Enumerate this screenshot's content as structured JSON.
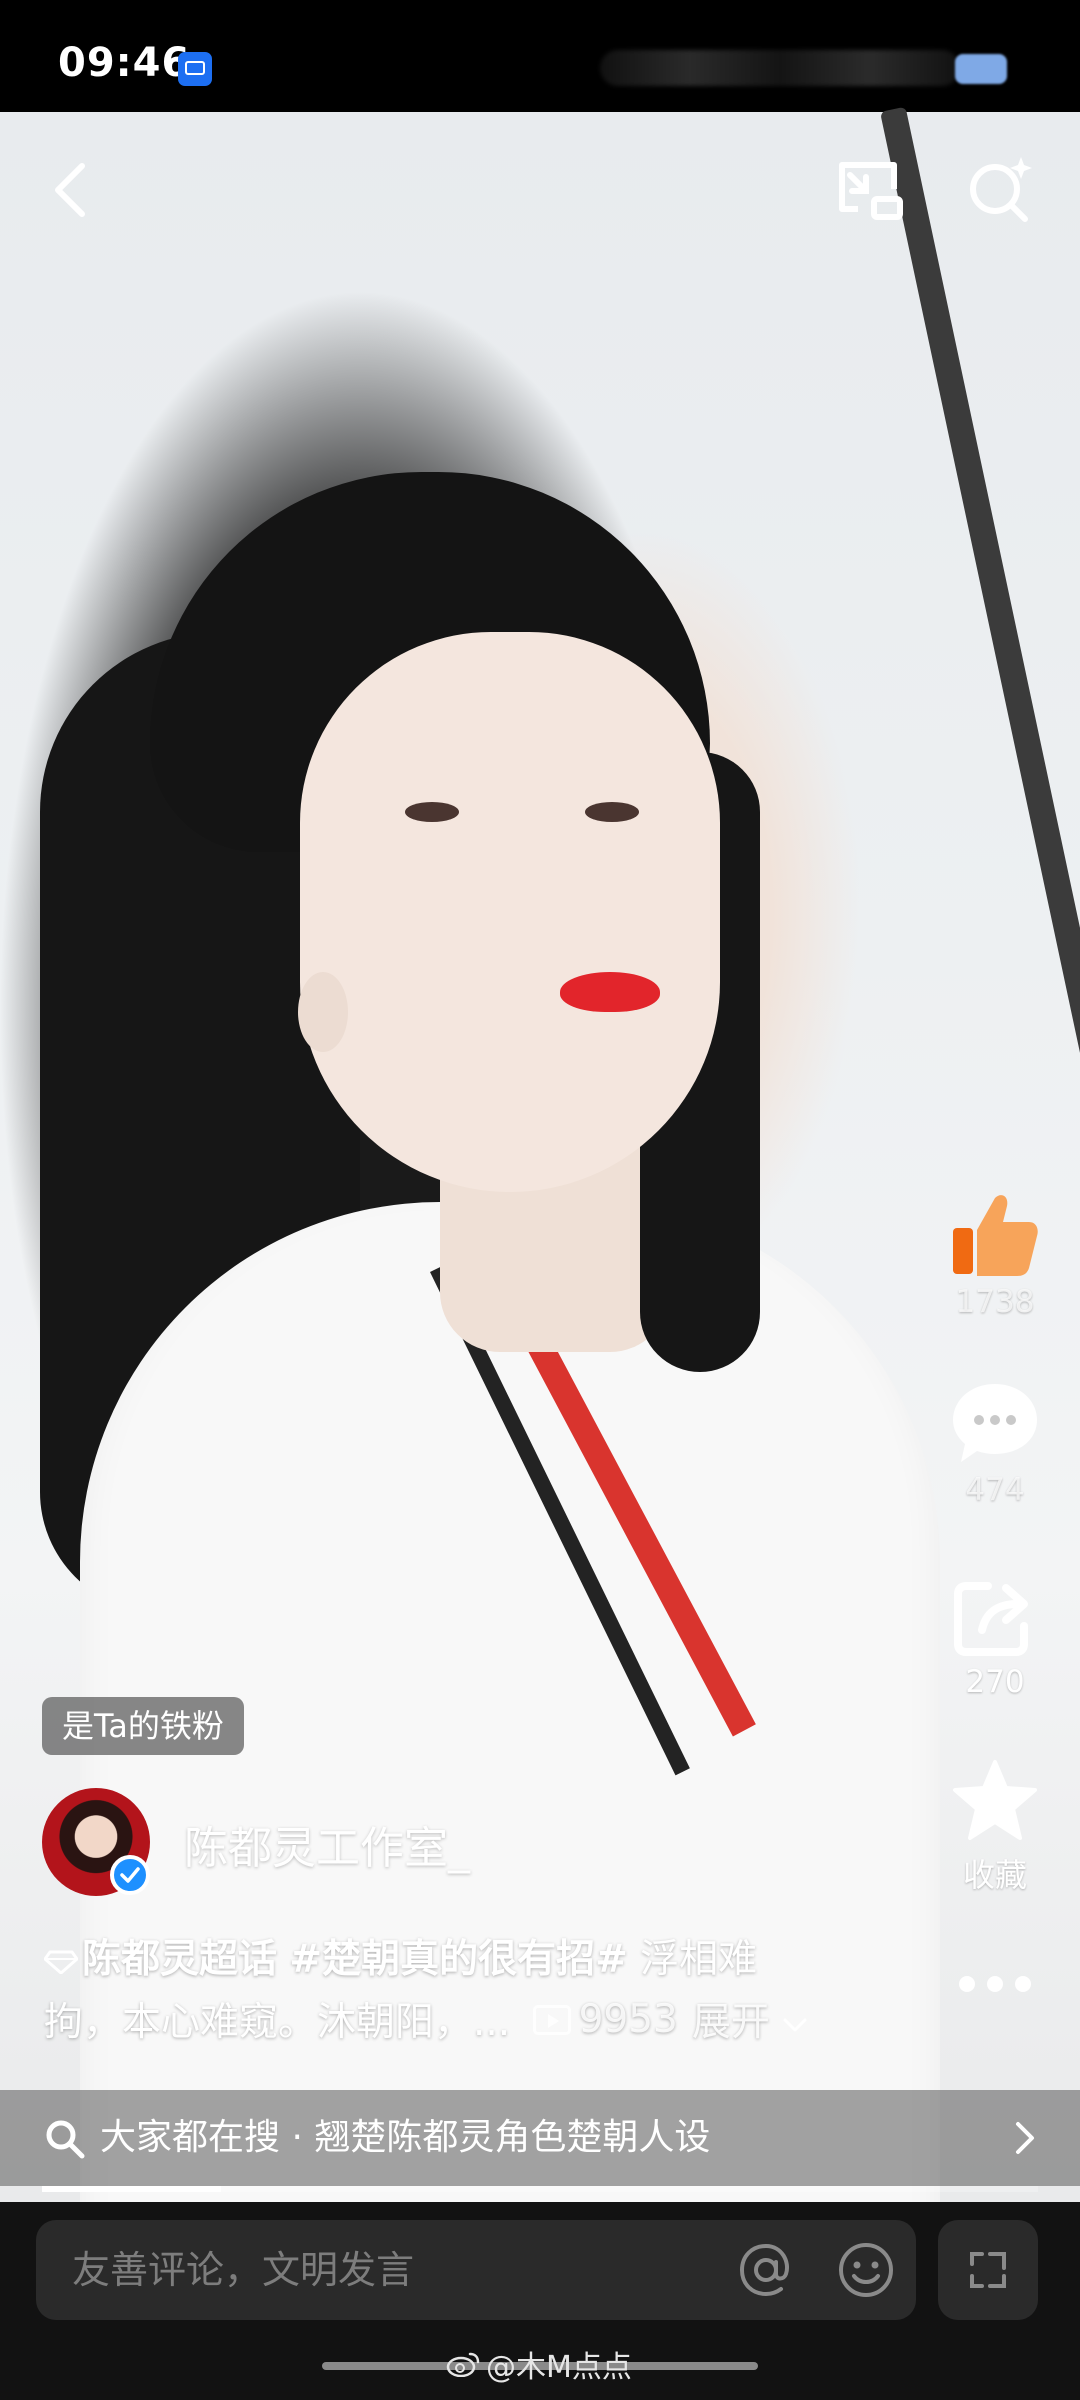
{
  "status_bar": {
    "time": "09:46"
  },
  "top_bar": {
    "back_icon": "chevron-left-icon",
    "pip_icon": "picture-in-picture-icon",
    "search_icon": "sparkle-search-icon"
  },
  "rail": {
    "like": {
      "icon": "thumbs-up-icon",
      "count": "1738",
      "color": "#f47a22"
    },
    "comment": {
      "icon": "comment-bubble-icon",
      "count": "474"
    },
    "share": {
      "icon": "share-icon",
      "count": "270"
    },
    "favorite": {
      "icon": "star-icon",
      "label": "收藏"
    },
    "more": {
      "icon": "more-dots-icon"
    }
  },
  "fan_badge": "是Ta的铁粉",
  "author": {
    "name": "陈都灵工作室_",
    "verified": true,
    "verified_color": "#1e90ff"
  },
  "caption": {
    "tag1": "陈都灵超话",
    "tag2": "#楚朝真的很有招#",
    "text_line1": " 浮相难",
    "text_line2": "拘，本心难窥。沐朝阳，...",
    "views": "9953",
    "expand": "展开"
  },
  "suggestion": {
    "text": "大家都在搜 · 翘楚陈都灵角色楚朝人设",
    "progress": 0.18
  },
  "comment_bar": {
    "placeholder": "友善评论，文明发言"
  },
  "watermark": "@木M点点"
}
